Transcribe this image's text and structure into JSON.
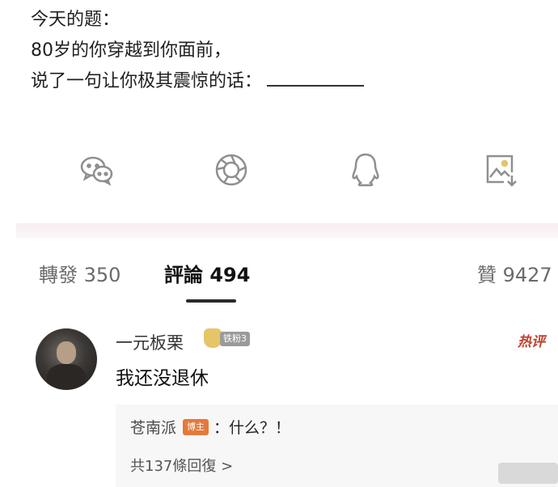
{
  "post": {
    "line1": "今天的题：",
    "line2": "80岁的你穿越到你面前，",
    "line3": "说了一句让你极其震惊的话："
  },
  "share": [
    {
      "icon": "wechat-icon"
    },
    {
      "icon": "moments-icon"
    },
    {
      "icon": "qq-icon"
    },
    {
      "icon": "save-image-icon"
    }
  ],
  "tabs": {
    "repost": "轉發 350",
    "comments": "評論 494",
    "likes": "贊 9427"
  },
  "comment": {
    "username": "一元板栗",
    "badge": "铁粉3",
    "hot_tag": "热评",
    "text": "我还没退休",
    "reply": {
      "user": "苍南派",
      "op_badge": "博主",
      "text": "：什么？！"
    },
    "more_replies": "共137條回復 >"
  },
  "colors": {
    "hot_tag": "#c2412d",
    "op_badge": "#e5793a",
    "reply_bg": "#f7f7f7"
  }
}
